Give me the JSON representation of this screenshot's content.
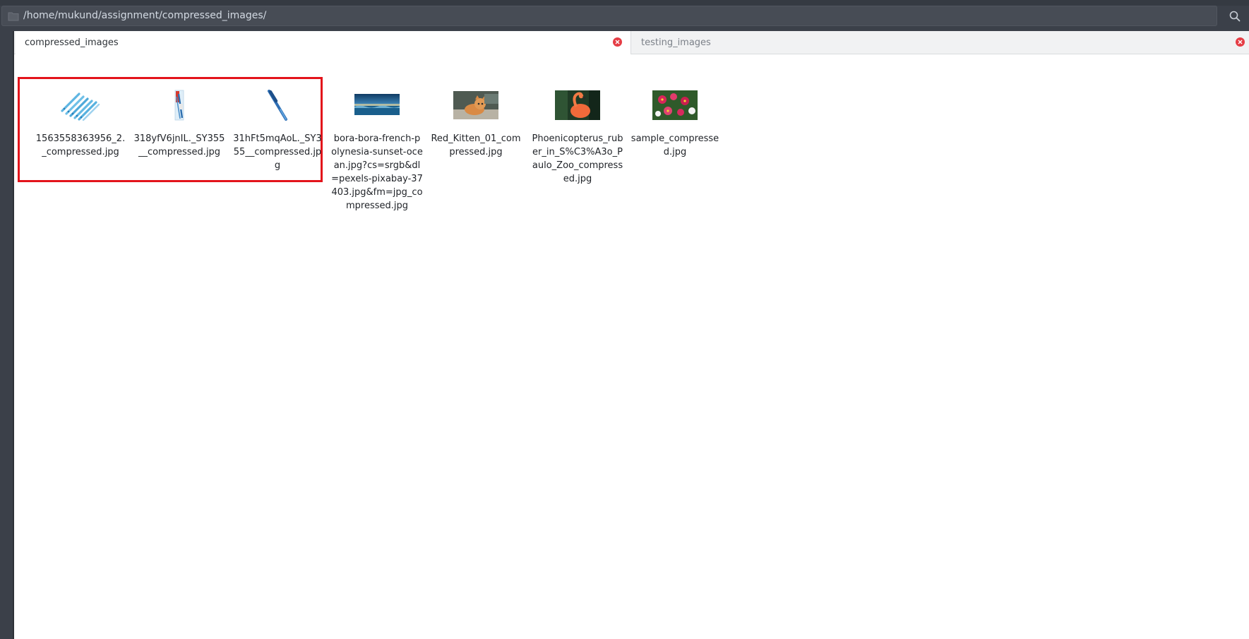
{
  "location": {
    "path": "/home/mukund/assignment/compressed_images/"
  },
  "tabs": [
    {
      "label": "compressed_images",
      "active": true
    },
    {
      "label": "testing_images",
      "active": false
    }
  ],
  "files": [
    {
      "name": "1563558363956_2._compressed.jpg",
      "thumb": "pens-thumbnail"
    },
    {
      "name": "318yfV6jnIL._SY355__compressed.jpg",
      "thumb": "pen-pack-thumbnail"
    },
    {
      "name": "31hFt5mqAoL._SY355__compressed.jpg",
      "thumb": "blue-pen-thumbnail"
    },
    {
      "name": "bora-bora-french-polynesia-sunset-ocean.jpg?cs=srgb&dl=pexels-pixabay-37403.jpg&fm=jpg_compressed.jpg",
      "thumb": "ocean-sunset-thumbnail"
    },
    {
      "name": "Red_Kitten_01_compressed.jpg",
      "thumb": "kitten-thumbnail"
    },
    {
      "name": "Phoenicopterus_ruber_in_S%C3%A3o_Paulo_Zoo_compressed.jpg",
      "thumb": "flamingo-thumbnail"
    },
    {
      "name": "sample_compressed.jpg",
      "thumb": "flowers-thumbnail"
    }
  ],
  "colors": {
    "selection_outline": "#e3141b",
    "close_icon": "#e53d45"
  }
}
